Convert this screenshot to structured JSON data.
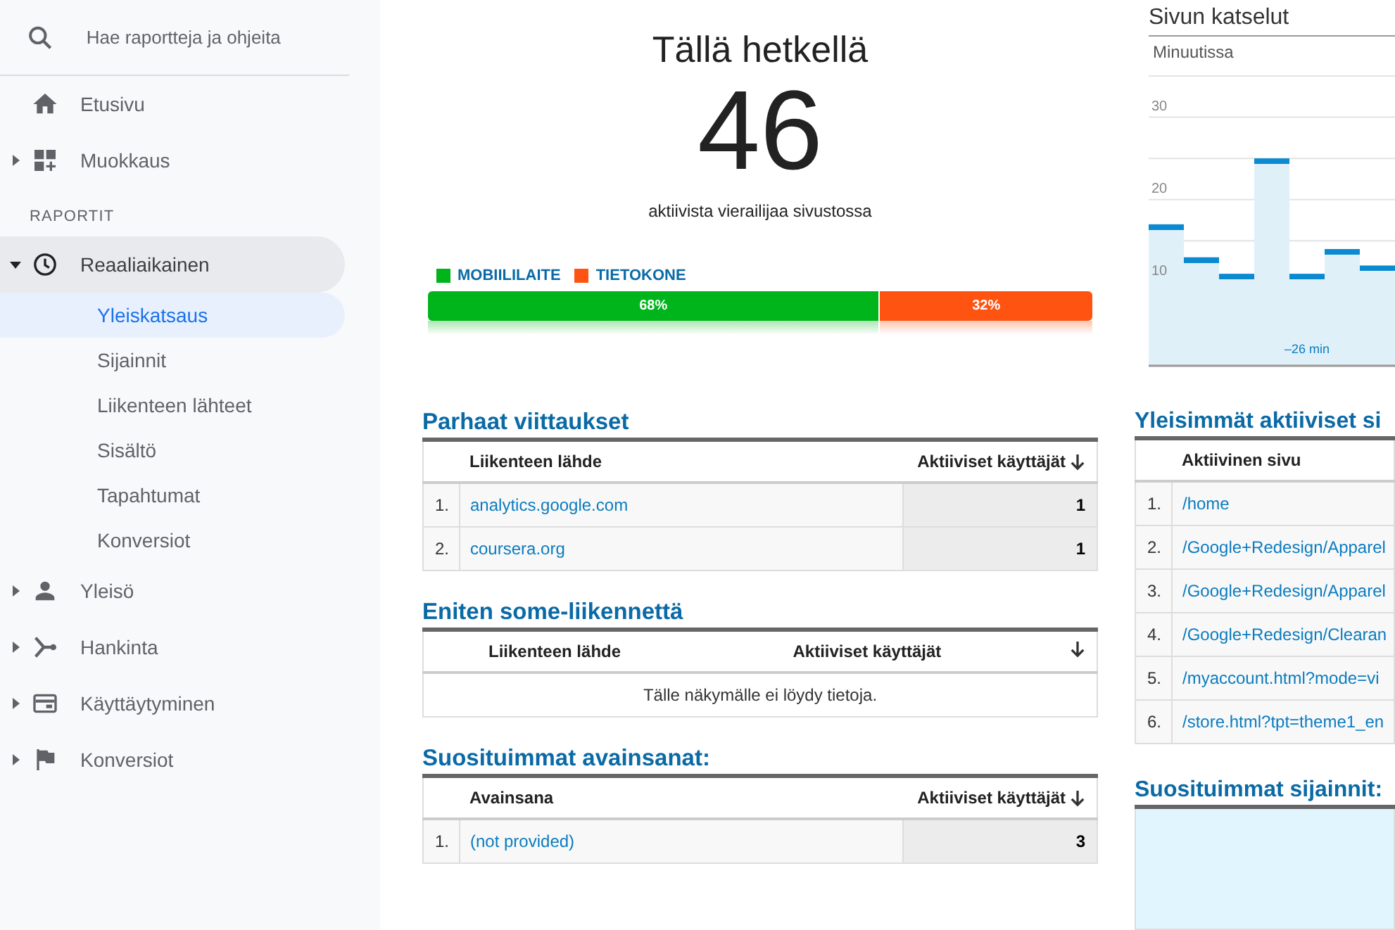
{
  "sidebar": {
    "search": {
      "placeholder": "Hae raportteja ja ohjeita"
    },
    "top_items": [
      {
        "label": "Etusivu"
      },
      {
        "label": "Muokkaus",
        "expanded": false
      }
    ],
    "section_label": "RAPORTIT",
    "report_items": [
      {
        "label": "Reaaliaikainen",
        "expanded": true,
        "active": true,
        "children": [
          {
            "label": "Yleiskatsaus",
            "selected": true
          },
          {
            "label": "Sijainnit",
            "selected": false
          },
          {
            "label": "Liikenteen lähteet",
            "selected": false
          },
          {
            "label": "Sisältö",
            "selected": false
          },
          {
            "label": "Tapahtumat",
            "selected": false
          },
          {
            "label": "Konversiot",
            "selected": false
          }
        ]
      },
      {
        "label": "Yleisö",
        "expanded": false,
        "active": false
      },
      {
        "label": "Hankinta",
        "expanded": false,
        "active": false
      },
      {
        "label": "Käyttäytyminen",
        "expanded": false,
        "active": false
      },
      {
        "label": "Konversiot",
        "expanded": false,
        "active": false
      }
    ]
  },
  "realtime": {
    "title": "Tällä hetkellä",
    "count": "46",
    "caption": "aktiivista vierailijaa sivustossa",
    "devices": [
      {
        "label": "MOBIILILAITE",
        "color": "#00b41c",
        "share": "68%"
      },
      {
        "label": "TIETOKONE",
        "color": "#ff5411",
        "share": "32%"
      }
    ]
  },
  "pageviews": {
    "title": "Sivun katselut",
    "subtitle": "Minuutissa",
    "chart_data": {
      "type": "bar",
      "values": [
        17,
        13,
        11,
        25,
        11,
        14,
        12
      ],
      "ylim": [
        0,
        35
      ],
      "yticks": [
        10,
        20,
        30
      ],
      "xlabel": "–26 min"
    }
  },
  "referrals": {
    "title": "Parhaat viittaukset",
    "columns": [
      "Liikenteen lähde",
      "Aktiiviset käyttäjät"
    ],
    "rows": [
      {
        "rank": "1.",
        "name": "analytics.google.com",
        "value": "1"
      },
      {
        "rank": "2.",
        "name": "coursera.org",
        "value": "1"
      }
    ]
  },
  "social": {
    "title": "Eniten some-liikennettä",
    "columns": [
      "Liikenteen lähde",
      "Aktiiviset käyttäjät"
    ],
    "empty_message": "Tälle näkymälle ei löydy tietoja."
  },
  "keywords": {
    "title": "Suosituimmat avainsanat:",
    "columns": [
      "Avainsana",
      "Aktiiviset käyttäjät"
    ],
    "rows": [
      {
        "rank": "1.",
        "name": "(not provided)",
        "value": "3"
      }
    ]
  },
  "top_pages": {
    "title": "Yleisimmät aktiiviset si",
    "columns": [
      "Aktiivinen sivu"
    ],
    "rows": [
      {
        "rank": "1.",
        "name": "/home"
      },
      {
        "rank": "2.",
        "name": "/Google+Redesign/Apparel"
      },
      {
        "rank": "3.",
        "name": "/Google+Redesign/Apparel"
      },
      {
        "rank": "4.",
        "name": "/Google+Redesign/Clearan"
      },
      {
        "rank": "5.",
        "name": "/myaccount.html?mode=vi"
      },
      {
        "rank": "6.",
        "name": "/store.html?tpt=theme1_en"
      }
    ]
  },
  "locations": {
    "title": "Suosituimmat sijainnit:"
  }
}
